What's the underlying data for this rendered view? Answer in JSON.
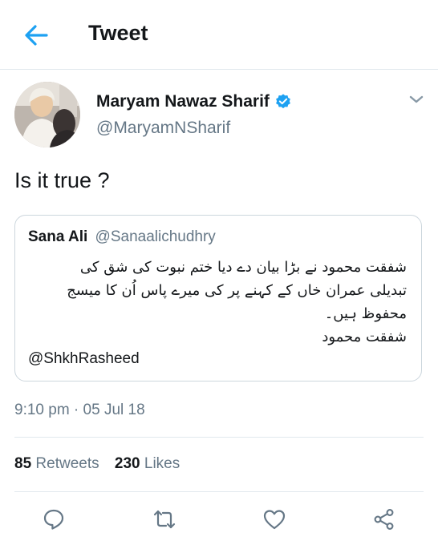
{
  "header": {
    "title": "Tweet",
    "back_icon": "arrow-left-icon"
  },
  "tweet": {
    "author_name": "Maryam Nawaz Sharif",
    "author_handle": "@MaryamNSharif",
    "verified": true,
    "text": "Is it true ?",
    "timestamp": "9:10 pm · 05 Jul 18",
    "retweets_count": "85",
    "retweets_label": "Retweets",
    "likes_count": "230",
    "likes_label": "Likes"
  },
  "quoted": {
    "name": "Sana Ali",
    "handle": "@Sanaalichudhry",
    "lines": [
      "شفقت محمود نے بڑا بیان دے دیا ختم نبوت کی شق کی",
      "تبدیلی عمران خاں کے کہنے پر کی میرے پاس اُن کا میسج",
      "محفوظ ہیں۔",
      "شفقت محمود"
    ],
    "mention": "@ShkhRasheed"
  },
  "actions": [
    "reply-icon",
    "retweet-icon",
    "like-icon",
    "share-icon"
  ],
  "colors": {
    "accent": "#1da1f2",
    "secondary_text": "#657786",
    "border": "#e1e8ed"
  }
}
